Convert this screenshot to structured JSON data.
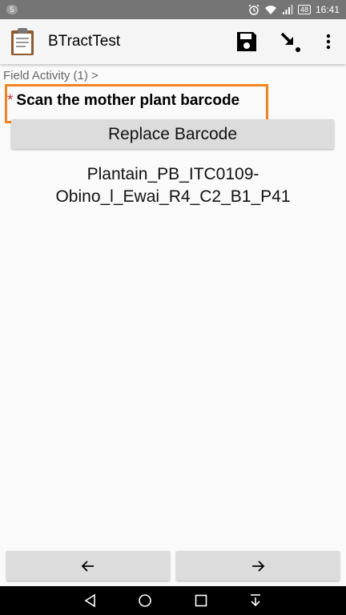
{
  "status_bar": {
    "notification_count": "5",
    "battery": "48",
    "time": "16:41",
    "icons": [
      "alarm-icon",
      "wifi-icon",
      "signal-icon",
      "battery-icon"
    ]
  },
  "app_bar": {
    "title": "BTractTest",
    "icons": [
      "clipboard-icon",
      "save-icon",
      "go-to-icon",
      "overflow-menu-icon"
    ]
  },
  "breadcrumb": "Field Activity (1) >",
  "question": {
    "required_marker": "*",
    "label": "Scan the mother plant barcode",
    "highlight_color": "#f58220"
  },
  "replace_button_label": "Replace Barcode",
  "barcode_value_line1": "Plantain_PB_ITC0109-",
  "barcode_value_line2": "Obino_l_Ewai_R4_C2_B1_P41",
  "footer_nav": {
    "prev_icon": "arrow-left-icon",
    "next_icon": "arrow-right-icon"
  },
  "system_nav": [
    "back-icon",
    "home-icon",
    "recents-icon",
    "notification-pulldown-icon"
  ]
}
